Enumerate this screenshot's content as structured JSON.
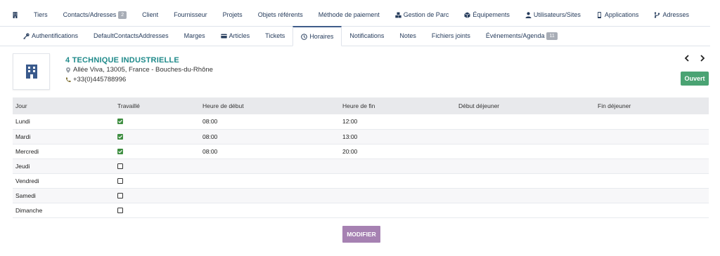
{
  "tabs_row1": [
    {
      "label": "",
      "icon": "building-icon"
    },
    {
      "label": "Tiers"
    },
    {
      "label": "Contacts/Adresses",
      "badge": "2"
    },
    {
      "label": "Client"
    },
    {
      "label": "Fournisseur"
    },
    {
      "label": "Projets"
    },
    {
      "label": "Objets référents"
    },
    {
      "label": "Méthode de paiement"
    },
    {
      "label": "Gestion de Parc",
      "icon": "cubes-icon"
    },
    {
      "label": "Équipements",
      "icon": "box-icon"
    },
    {
      "label": "Utilisateurs/Sites",
      "icon": "user-icon"
    },
    {
      "label": "Applications",
      "icon": "mobile-icon"
    },
    {
      "label": "Adresses",
      "icon": "code-branch-icon"
    }
  ],
  "tabs_row2": [
    {
      "label": "Authentifications",
      "icon": "key-icon"
    },
    {
      "label": "DefaultContactsAddresses"
    },
    {
      "label": "Marges"
    },
    {
      "label": "Articles",
      "icon": "card-icon"
    },
    {
      "label": "Tickets"
    },
    {
      "label": "Horaires",
      "icon": "clock-icon",
      "active": true
    },
    {
      "label": "Notifications"
    },
    {
      "label": "Notes"
    },
    {
      "label": "Fichiers joints"
    },
    {
      "label": "Événements/Agenda",
      "badge": "11"
    }
  ],
  "company": {
    "name": "4 TECHNIQUE INDUSTRIELLE",
    "address": "Allée Viva, 13005, France - Bouches-du-Rhône",
    "phone": "+33(0)445788996"
  },
  "status": {
    "label": "Ouvert",
    "color": "#4aa373"
  },
  "schedule": {
    "headers": [
      "Jour",
      "Travaillé",
      "Heure de début",
      "Heure de fin",
      "Début déjeuner",
      "Fin déjeuner"
    ],
    "rows": [
      {
        "day": "Lundi",
        "worked": true,
        "start": "08:00",
        "end": "12:00",
        "lunch_start": "",
        "lunch_end": ""
      },
      {
        "day": "Mardi",
        "worked": true,
        "start": "08:00",
        "end": "13:00",
        "lunch_start": "",
        "lunch_end": ""
      },
      {
        "day": "Mercredi",
        "worked": true,
        "start": "08:00",
        "end": "20:00",
        "lunch_start": "",
        "lunch_end": ""
      },
      {
        "day": "Jeudi",
        "worked": false,
        "start": "",
        "end": "",
        "lunch_start": "",
        "lunch_end": ""
      },
      {
        "day": "Vendredi",
        "worked": false,
        "start": "",
        "end": "",
        "lunch_start": "",
        "lunch_end": ""
      },
      {
        "day": "Samedi",
        "worked": false,
        "start": "",
        "end": "",
        "lunch_start": "",
        "lunch_end": ""
      },
      {
        "day": "Dimanche",
        "worked": false,
        "start": "",
        "end": "",
        "lunch_start": "",
        "lunch_end": ""
      }
    ]
  },
  "actions": {
    "modify_label": "MODIFIER"
  },
  "colors": {
    "accent": "#3f5c8a",
    "teal": "#1f8a8a",
    "button": "#a681b2",
    "check": "#3e8e41"
  }
}
